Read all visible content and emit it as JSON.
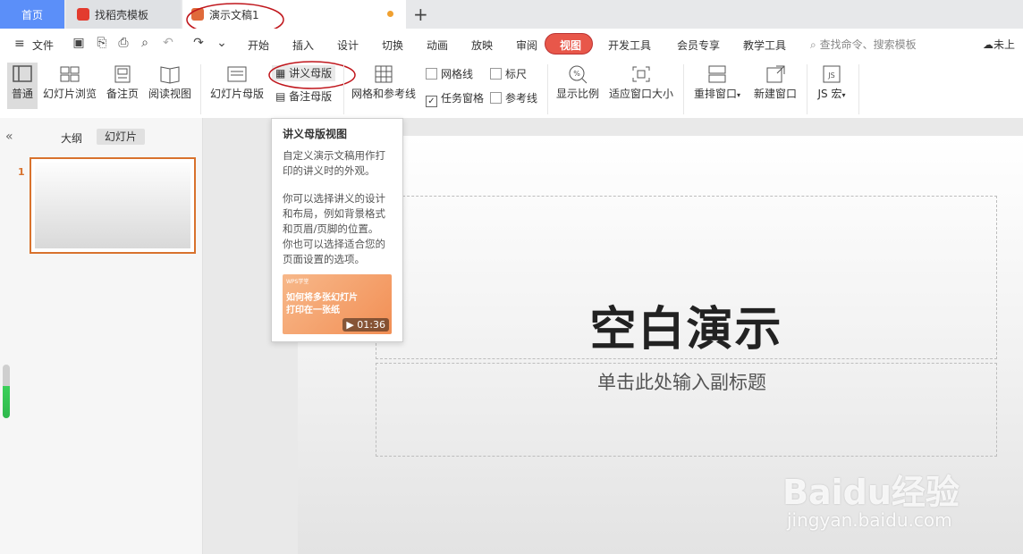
{
  "tabs": [
    {
      "label": "首页"
    },
    {
      "label": "找稻壳模板"
    },
    {
      "label": "演示文稿1"
    }
  ],
  "menu": {
    "file": "文件",
    "items": [
      "开始",
      "插入",
      "设计",
      "切换",
      "动画",
      "放映",
      "审阅",
      "视图",
      "开发工具",
      "会员专享",
      "教学工具"
    ],
    "search_placeholder": "查找命令、搜索模板",
    "cloud": "未上"
  },
  "ribbon": {
    "normal": "普通",
    "slide_browse": "幻灯片浏览",
    "notes_page": "备注页",
    "reading_view": "阅读视图",
    "slide_master": "幻灯片母版",
    "handout_master": "讲义母版",
    "notes_master": "备注母版",
    "grid_guides": "网格和参考线",
    "gridlines": "网格线",
    "ruler": "标尺",
    "task_pane": "任务窗格",
    "guides": "参考线",
    "zoom": "显示比例",
    "fit_window": "适应窗口大小",
    "arrange": "重排窗口",
    "new_window": "新建窗口",
    "js_macro": "JS 宏"
  },
  "checkboxes": {
    "gridlines": false,
    "ruler": false,
    "task_pane": true,
    "guides": false
  },
  "left_panel": {
    "outline_tab": "大纲",
    "slides_tab": "幻灯片",
    "slide_number": "1"
  },
  "tooltip": {
    "title": "讲义母版视图",
    "body1": "自定义演示文稿用作打\n印的讲义时的外观。",
    "body2": "你可以选择讲义的设计\n和布局，例如背景格式\n和页眉/页脚的位置。\n你也可以选择适合您的\n页面设置的选项。",
    "video_title": "如何将多张幻灯片\n打印在一张纸",
    "video_brand": "WPS学堂",
    "video_duration": "01:36"
  },
  "slide": {
    "title": "空白演示",
    "subtitle": "单击此处输入副标题"
  },
  "watermark": {
    "brand": "Baidu经验",
    "url": "jingyan.baidu.com"
  },
  "colors": {
    "accent": "#e8574a",
    "home_tab": "#5b8ff9",
    "selection": "#d8722d",
    "annotation": "#c0161c"
  }
}
